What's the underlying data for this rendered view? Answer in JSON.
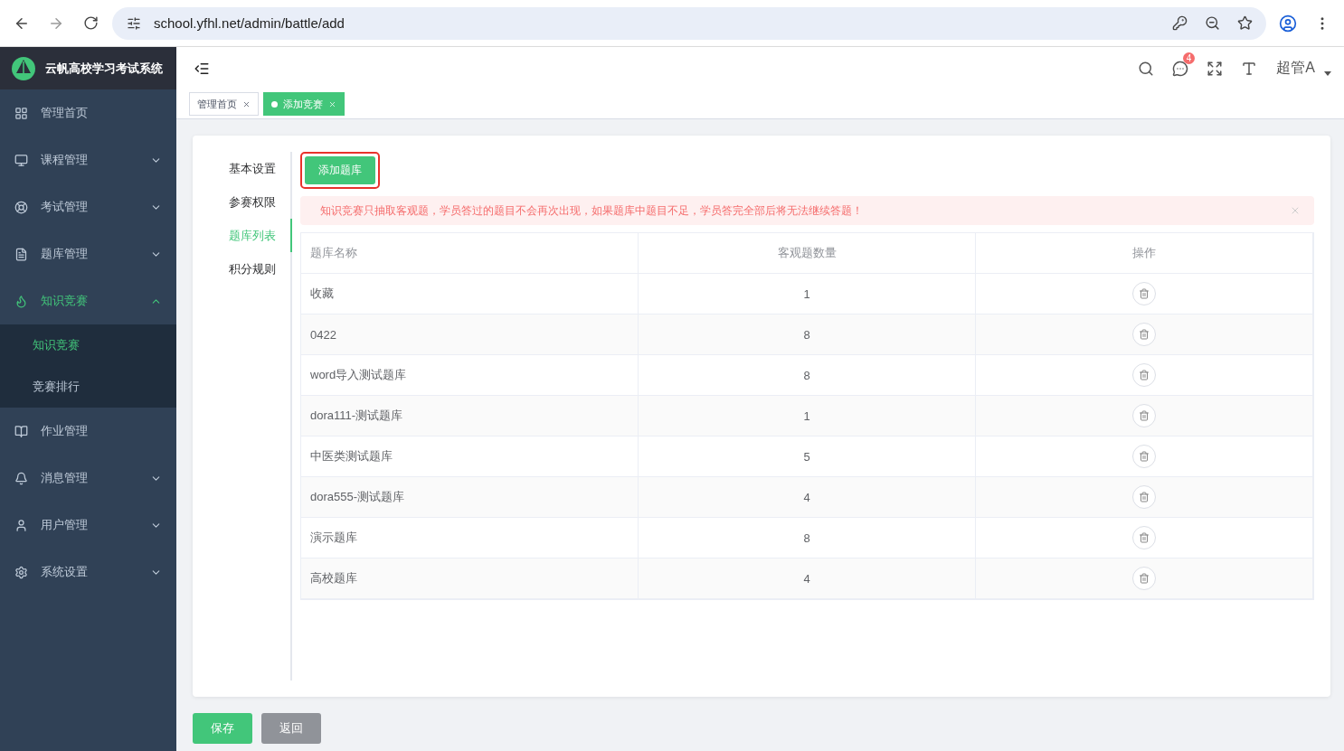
{
  "browser": {
    "url": "school.yfhl.net/admin/battle/add"
  },
  "sidebar": {
    "title": "云帆高校学习考试系统",
    "items": [
      {
        "kind": "link",
        "label": "管理首页",
        "selected": false
      },
      {
        "kind": "group",
        "label": "课程管理",
        "selected": false,
        "expanded": false
      },
      {
        "kind": "group",
        "label": "考试管理",
        "selected": false,
        "expanded": false
      },
      {
        "kind": "group",
        "label": "题库管理",
        "selected": false,
        "expanded": false
      },
      {
        "kind": "group",
        "label": "知识竞赛",
        "selected": true,
        "expanded": true,
        "children": [
          {
            "label": "知识竞赛",
            "selected": true
          },
          {
            "label": "竞赛排行",
            "selected": false
          }
        ]
      },
      {
        "kind": "link",
        "label": "作业管理",
        "selected": false
      },
      {
        "kind": "group",
        "label": "消息管理",
        "selected": false,
        "expanded": false
      },
      {
        "kind": "group",
        "label": "用户管理",
        "selected": false,
        "expanded": false
      },
      {
        "kind": "group",
        "label": "系统设置",
        "selected": false,
        "expanded": false
      }
    ]
  },
  "header": {
    "notification_count": "4",
    "user": "超管A"
  },
  "tabs": [
    {
      "label": "管理首页",
      "selected": false
    },
    {
      "label": "添加竞赛",
      "selected": true
    }
  ],
  "steps": [
    {
      "label": "基本设置",
      "selected": false
    },
    {
      "label": "参赛权限",
      "selected": false
    },
    {
      "label": "题库列表",
      "selected": true
    },
    {
      "label": "积分规则",
      "selected": false
    }
  ],
  "add_button": "添加题库",
  "alert": "知识竞赛只抽取客观题，学员答过的题目不会再次出现，如果题库中题目不足，学员答完全部后将无法继续答题！",
  "table": {
    "columns": [
      "题库名称",
      "客观题数量",
      "操作"
    ],
    "rows": [
      {
        "name": "收藏",
        "count": "1"
      },
      {
        "name": "0422",
        "count": "8"
      },
      {
        "name": "word导入测试题库",
        "count": "8"
      },
      {
        "name": "dora111-测试题库",
        "count": "1"
      },
      {
        "name": "中医类测试题库",
        "count": "5"
      },
      {
        "name": "dora555-测试题库",
        "count": "4"
      },
      {
        "name": "演示题库",
        "count": "8"
      },
      {
        "name": "高校题库",
        "count": "4"
      }
    ]
  },
  "footer_buttons": [
    {
      "kind": "primary",
      "label": "保存"
    },
    {
      "kind": "secondary",
      "label": "返回"
    }
  ]
}
